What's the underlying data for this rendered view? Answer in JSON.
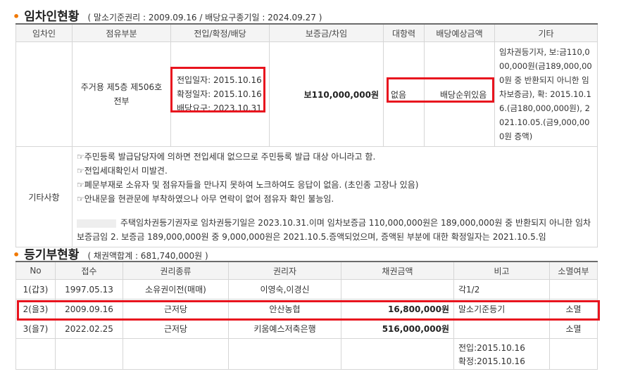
{
  "section1": {
    "title": "임차인현황",
    "subtitle": "( 말소기준권리 : 2009.09.16 / 배당요구종기일 : 2024.09.27 )"
  },
  "tenant_table": {
    "headers": [
      "임차인",
      "점유부분",
      "전입/확정/배당",
      "보증금/차임",
      "대항력",
      "배당예상금액",
      "기타"
    ],
    "row": {
      "tenant": "",
      "occupancy": "주거용 제5층 제506호 전부",
      "move_in": "전입일자: 2015.10.16",
      "fixed": "확정일자: 2015.10.16",
      "claim": "배당요구: 2023.10.31",
      "deposit": "보110,000,000원",
      "opposability": "없음",
      "expected_dividend": "배당순위있음",
      "etc": "임차권등기자, 보:금110,000,000원(금189,000,000원 중 반환되지 아니한 임차보증금), 확: 2015.10.16.(금180,000,000원), 2021.10.05.(금9,000,000원 증액)"
    },
    "other_label": "기타사항",
    "other_notes": [
      "☞주민등록 발급담당자에 의하면 전입세대 없으므로 주민등록 발급 대상 아니라고 함.",
      "☞전입세대확인서 미발견.",
      "☞폐문부재로 소유자 및 점유자들을 만나지 못하여 노크하여도 응답이 없음. (초인종 고장나 있음)",
      "☞안내문을 현관문에 부착하였으나 아무 연락이 없어 점유자 확인 불능임."
    ],
    "other_extra": "주택임차권등기권자로 임차권등기일은 2023.10.31.이며 임차보증금 110,000,000원은 189,000,000원 중 반환되지 아니한 임차보증금임 2. 보증금 189,000,000원 중 9,000,000원은 2021.10.5.증액되었으며, 증액된 부분에 대한 확정일자는 2021.10.5.임"
  },
  "section2": {
    "title": "등기부현황",
    "subtitle": "( 채권액합계 : 681,740,000원 )"
  },
  "registry_table": {
    "headers": [
      "No",
      "접수",
      "권리종류",
      "권리자",
      "채권금액",
      "비고",
      "소멸여부"
    ],
    "rows": [
      {
        "no": "1(갑3)",
        "date": "1997.05.13",
        "type": "소유권이전(매매)",
        "holder": "이영숙,이경신",
        "amount": "",
        "note": "각1/2",
        "extinct": ""
      },
      {
        "no": "2(을3)",
        "date": "2009.09.16",
        "type": "근저당",
        "holder": "안산농협",
        "amount": "16,800,000원",
        "note": "말소기준등기",
        "extinct": "소멸"
      },
      {
        "no": "3(을7)",
        "date": "2022.02.25",
        "type": "근저당",
        "holder": "키움예스저축은행",
        "amount": "516,000,000원",
        "note": "",
        "extinct": "소멸"
      },
      {
        "no": "",
        "date": "",
        "type": "",
        "holder": "",
        "amount": "",
        "note": "전입:2015.10.16",
        "note2": "확정:2015.10.16",
        "extinct": ""
      }
    ]
  },
  "highlight_color": "#e8141e",
  "accent_color": "#f07800"
}
